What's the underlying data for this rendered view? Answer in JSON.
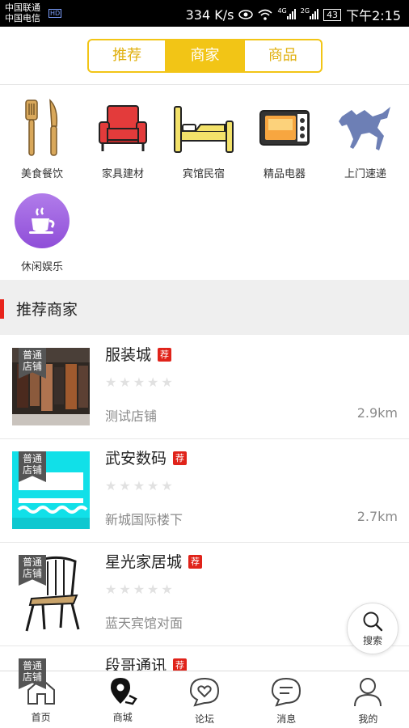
{
  "status_bar": {
    "carrier_1": "中国联通",
    "carrier_2": "中国电信",
    "hd": "HD",
    "speed": "334 K/s",
    "net_1": "4G",
    "net_2": "2G",
    "battery": "43",
    "time": "下午2:15"
  },
  "tabs": [
    {
      "label": "推荐",
      "active": false
    },
    {
      "label": "商家",
      "active": true
    },
    {
      "label": "商品",
      "active": false
    }
  ],
  "categories": [
    {
      "label": "美食餐饮",
      "icon": "cutlery-icon"
    },
    {
      "label": "家具建材",
      "icon": "armchair-icon"
    },
    {
      "label": "宾馆民宿",
      "icon": "bed-icon"
    },
    {
      "label": "精品电器",
      "icon": "microwave-icon"
    },
    {
      "label": "上门速递",
      "icon": "horse-icon"
    },
    {
      "label": "休闲娱乐",
      "icon": "coffee-cup-icon"
    }
  ],
  "section": {
    "title": "推荐商家"
  },
  "stores": [
    {
      "name": "服装城",
      "badge": "普通\n店铺",
      "tag": "荐",
      "rating": 0,
      "address": "测试店铺",
      "distance": "2.9km"
    },
    {
      "name": "武安数码",
      "badge": "普通\n店铺",
      "tag": "荐",
      "rating": 0,
      "address": "新城国际楼下",
      "distance": "2.7km"
    },
    {
      "name": "星光家居城",
      "badge": "普通\n店铺",
      "tag": "荐",
      "rating": 0,
      "address": "蓝天宾馆对面",
      "distance": ""
    },
    {
      "name": "段哥通讯",
      "badge": "普通\n店铺",
      "tag": "荐",
      "rating": 0,
      "address": "",
      "distance": ""
    }
  ],
  "floating_search": {
    "label": "搜索",
    "icon": "search-icon"
  },
  "bottom_nav": [
    {
      "label": "首页",
      "icon": "home-icon",
      "active": false
    },
    {
      "label": "商城",
      "icon": "map-pin-icon",
      "active": true
    },
    {
      "label": "论坛",
      "icon": "heart-chat-icon",
      "active": false
    },
    {
      "label": "消息",
      "icon": "message-icon",
      "active": false
    },
    {
      "label": "我的",
      "icon": "user-icon",
      "active": false
    }
  ],
  "colors": {
    "accent": "#f2c516",
    "section_marker": "#e8241c",
    "tag": "#e0231a"
  }
}
